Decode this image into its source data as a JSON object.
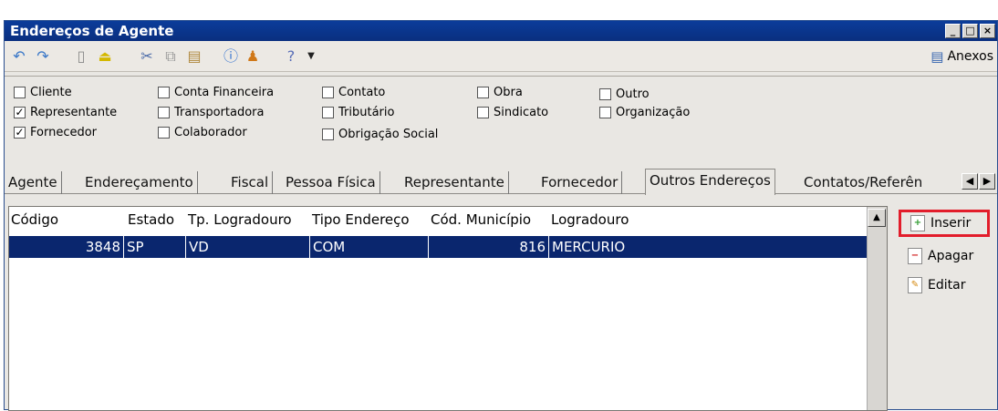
{
  "window": {
    "title": "Endereços de Agente",
    "buttons": [
      "_",
      "□",
      "×"
    ]
  },
  "toolbar": {
    "icons": [
      "undo-icon",
      "redo-icon",
      "new-document-icon",
      "eject-icon",
      "cut-icon",
      "copy-icon",
      "paste-icon",
      "info-icon",
      "users-icon",
      "help-icon",
      "dropdown-arrow-icon"
    ],
    "anexos_label": "Anexos"
  },
  "checkboxes": [
    {
      "label": "Cliente",
      "checked": false
    },
    {
      "label": "Representante",
      "checked": true
    },
    {
      "label": "Fornecedor",
      "checked": true
    },
    {
      "label": "Conta Financeira",
      "checked": false
    },
    {
      "label": "Transportadora",
      "checked": false
    },
    {
      "label": "Colaborador",
      "checked": false
    },
    {
      "label": "Contato",
      "checked": false
    },
    {
      "label": "Tributário",
      "checked": false
    },
    {
      "label": "Obrigação Social",
      "checked": false
    },
    {
      "label": "Obra",
      "checked": false
    },
    {
      "label": "Sindicato",
      "checked": false
    },
    {
      "label": "Outro",
      "checked": false
    },
    {
      "label": "Organização",
      "checked": false
    }
  ],
  "tabs": [
    {
      "label": "Agente"
    },
    {
      "label": "Endereçamento"
    },
    {
      "label": "Fiscal"
    },
    {
      "label": "Pessoa Física"
    },
    {
      "label": "Representante"
    },
    {
      "label": "Fornecedor"
    },
    {
      "label": "Outros Endereços",
      "active": true
    },
    {
      "label": "Contatos/Referên"
    }
  ],
  "grid": {
    "columns": [
      "Código",
      "Estado",
      "Tp. Logradouro",
      "Tipo Endereço",
      "Cód. Município",
      "Logradouro"
    ],
    "rows": [
      {
        "codigo": "3848",
        "estado": "SP",
        "tp_logradouro": "VD",
        "tipo_endereco": "COM",
        "cod_municipio": "816",
        "logradouro": "MERCURIO"
      }
    ]
  },
  "actions": {
    "inserir": "Inserir",
    "apagar": "Apagar",
    "editar": "Editar"
  },
  "colors": {
    "selection": "#0a266e",
    "highlight": "#e21d2b",
    "titlebar": "#0b3c9a"
  }
}
